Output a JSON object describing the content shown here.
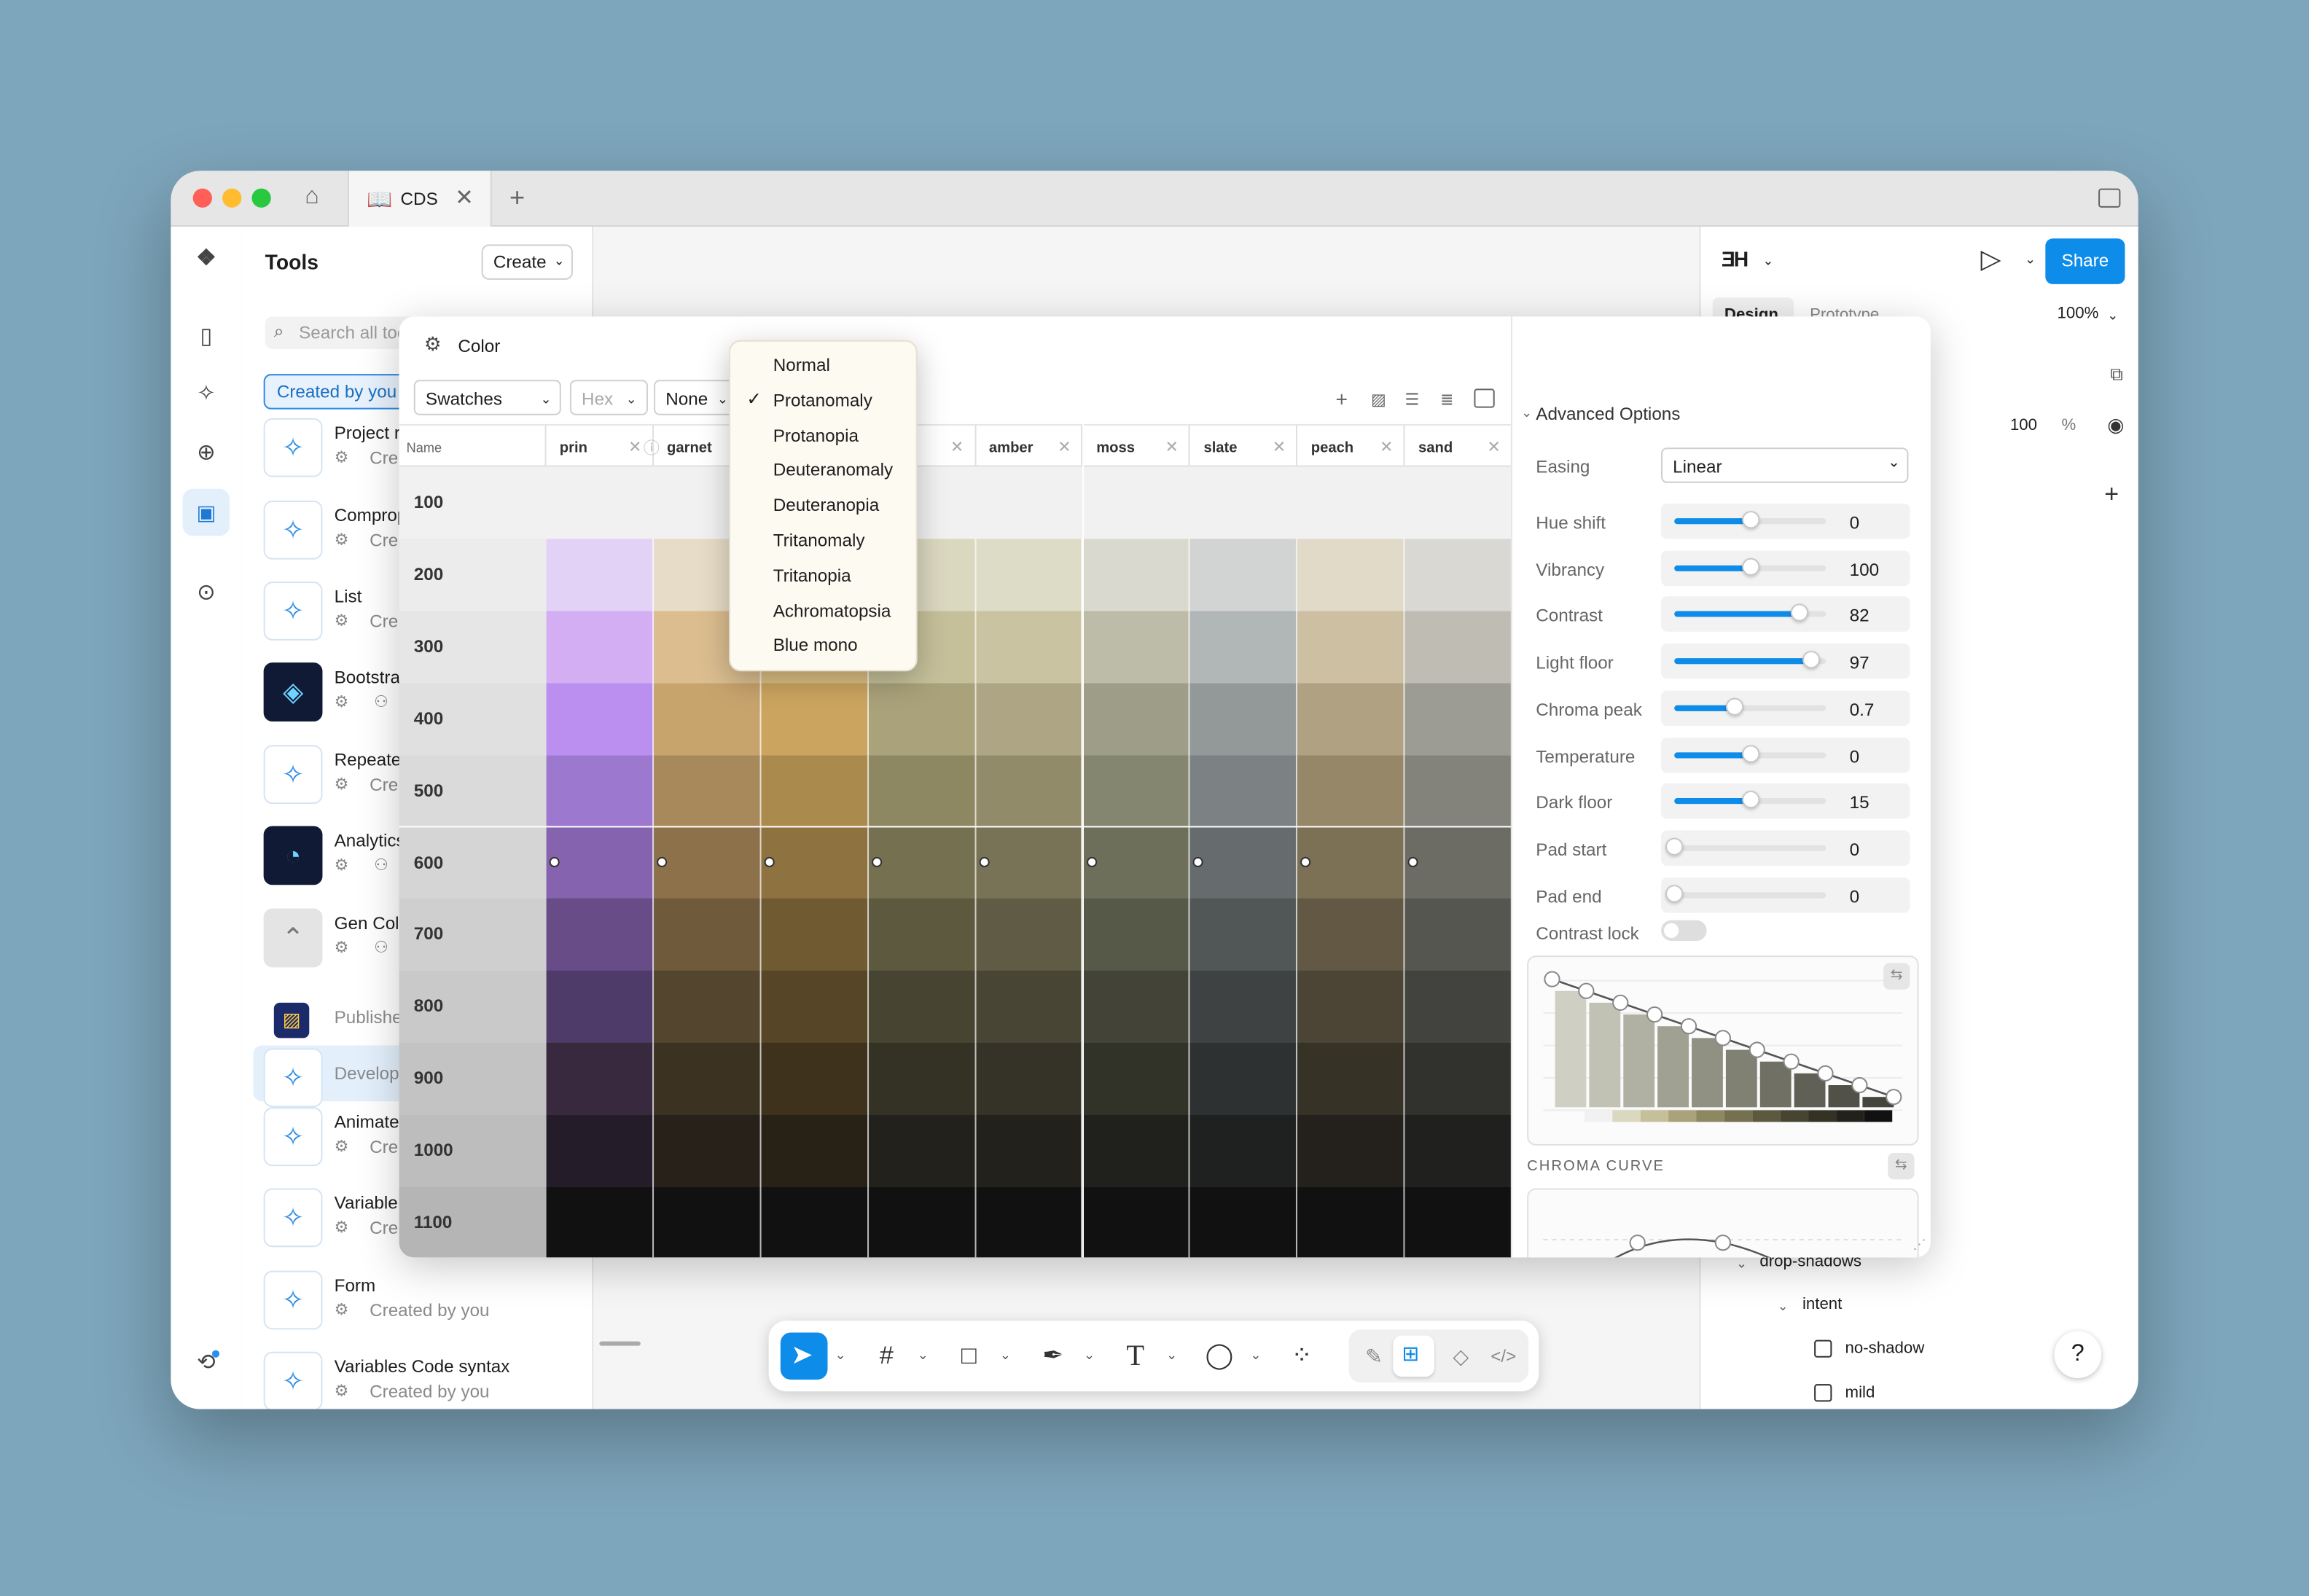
{
  "window": {
    "tab_label": "CDS",
    "new_tab_symbol": "+"
  },
  "tools_panel": {
    "title": "Tools",
    "create_label": "Create",
    "search_placeholder": "Search all tools",
    "filter_chip": "Created by you",
    "items": [
      {
        "name": "Project r",
        "sub": "Cre",
        "icon": "sparkle-icon"
      },
      {
        "name": "Comprop",
        "sub": "Cre",
        "icon": "sparkle-icon"
      },
      {
        "name": "List",
        "sub": "Cre",
        "icon": "sparkle-icon"
      },
      {
        "name": "Bootstra",
        "sub": "",
        "icon": "stack-icon"
      },
      {
        "name": "Repeate",
        "sub": "Cre",
        "icon": "sparkle-icon"
      },
      {
        "name": "Analytics",
        "sub": "",
        "icon": "analytics-icon"
      },
      {
        "name": "Gen Colo",
        "sub": "",
        "icon": "chevron-up-icon"
      },
      {
        "name": "Publishe",
        "sub": "",
        "icon": "publish-icon"
      },
      {
        "name": "Develop",
        "sub": "",
        "icon": "sparkle-icon"
      },
      {
        "name": "Animate",
        "sub": "Cre",
        "icon": "sparkle-icon"
      },
      {
        "name": "Variable",
        "sub": "Cre",
        "icon": "sparkle-icon"
      },
      {
        "name": "Form",
        "sub": "Created by you",
        "icon": "sparkle-icon"
      },
      {
        "name": "Variables Code syntax",
        "sub": "Created by you",
        "icon": "sparkle-icon"
      }
    ]
  },
  "right_panel": {
    "share_label": "Share",
    "tab_design": "Design",
    "tab_prototype": "Prototype",
    "zoom": "100%",
    "opacity_value": "100",
    "opacity_unit": "%",
    "tree": {
      "group": "drop-shadows",
      "subgroup": "intent",
      "items": [
        "no-shadow",
        "mild"
      ]
    },
    "help_symbol": "?"
  },
  "color_modal": {
    "title": "Color",
    "view_select": "Swatches",
    "format_select": "Hex",
    "vision_select": "None",
    "name_header": "Name",
    "columns": [
      "prin",
      "garnet",
      "",
      "",
      "amber",
      "moss",
      "slate",
      "peach",
      "sand"
    ],
    "rows": [
      "100",
      "200",
      "300",
      "400",
      "500",
      "600",
      "700",
      "800",
      "900",
      "1000",
      "1100"
    ],
    "swatches": [
      [
        "#f1f1f1",
        "#f1f1f1",
        "#f1f1f1",
        "#f1f1f1",
        "#f1f1f1",
        "#f1f1f1",
        "#f1f1f1",
        "#f1f1f1",
        "#f1f1f1"
      ],
      [
        "#e2d2f5",
        "#e7dcc7",
        "#e8dbbd",
        "#dbd8c0",
        "#dddcc7",
        "#d9d9cf",
        "#d2d4d4",
        "#e2dac9",
        "#dad8d3"
      ],
      [
        "#d3aef3",
        "#dbbd8f",
        "#dcbf82",
        "#c5c09a",
        "#c9c3a2",
        "#bdbca8",
        "#b1b6b6",
        "#cdbfa2",
        "#bebcb3"
      ],
      [
        "#bb8ff0",
        "#c8a46d",
        "#cba560",
        "#a9a27a",
        "#ada583",
        "#9e9e88",
        "#939999",
        "#b0a183",
        "#9d9c94"
      ],
      [
        "#9d78cf",
        "#a8895b",
        "#ab8a4e",
        "#8e8862",
        "#918b69",
        "#858670",
        "#7c8283",
        "#958767",
        "#84837b"
      ],
      [
        "#8563ae",
        "#8c714b",
        "#8e7240",
        "#757050",
        "#787356",
        "#6d6f5b",
        "#666c6d",
        "#7c7055",
        "#6c6c65"
      ],
      [
        "#674c88",
        "#6f5a3b",
        "#705a32",
        "#5d593f",
        "#5f5b44",
        "#575948",
        "#515657",
        "#625844",
        "#565651"
      ],
      [
        "#4f3b69",
        "#54452e",
        "#564527",
        "#474431",
        "#484535",
        "#434437",
        "#3f4243",
        "#4c4435",
        "#42423e"
      ],
      [
        "#39293f",
        "#3c3222",
        "#3e321c",
        "#343224",
        "#353227",
        "#313228",
        "#2e3131",
        "#373226",
        "#31312d"
      ],
      [
        "#241d29",
        "#27211a",
        "#282116",
        "#22211b",
        "#22211c",
        "#20211d",
        "#1f2121",
        "#24211c",
        "#20201e"
      ],
      [
        "#111111",
        "#111111",
        "#111111",
        "#111111",
        "#111111",
        "#111111",
        "#111111",
        "#111111",
        "#111111"
      ]
    ],
    "vision_menu": {
      "items": [
        "Normal",
        "Protanomaly",
        "Protanopia",
        "Deuteranomaly",
        "Deuteranopia",
        "Tritanomaly",
        "Tritanopia",
        "Achromatopsia",
        "Blue mono"
      ],
      "checked": "Protanomaly"
    },
    "advanced": {
      "title": "Advanced Options",
      "easing_label": "Easing",
      "easing_value": "Linear",
      "params": [
        {
          "label": "Hue shift",
          "value": "0",
          "fraction": 0.5
        },
        {
          "label": "Vibrancy",
          "value": "100",
          "fraction": 0.5
        },
        {
          "label": "Contrast",
          "value": "82",
          "fraction": 0.82
        },
        {
          "label": "Light floor",
          "value": "97",
          "fraction": 0.9
        },
        {
          "label": "Chroma peak",
          "value": "0.7",
          "fraction": 0.4
        },
        {
          "label": "Temperature",
          "value": "0",
          "fraction": 0.5
        },
        {
          "label": "Dark floor",
          "value": "15",
          "fraction": 0.5
        },
        {
          "label": "Pad start",
          "value": "0",
          "fraction": 0
        },
        {
          "label": "Pad end",
          "value": "0",
          "fraction": 0
        }
      ],
      "contrast_lock_label": "Contrast lock",
      "contrast_lock_on": false,
      "curve_bar_colors": [
        "#dcdcd1",
        "#cfcfc3",
        "#c1c1b4",
        "#b1b1a3",
        "#a1a193",
        "#909083",
        "#808073",
        "#707064",
        "#606056",
        "#515148",
        "#45453d"
      ],
      "chroma_curve_label": "CHROMA CURVE"
    }
  },
  "bottom_toolbar": {
    "tools": [
      "move-tool-icon",
      "frame-tool-icon",
      "shape-tool-icon",
      "pen-tool-icon",
      "text-tool-icon",
      "comment-tool-icon",
      "actions-icon"
    ],
    "modes": [
      "draw-mode-icon",
      "design-mode-icon",
      "component-mode-icon",
      "dev-mode-icon"
    ]
  }
}
